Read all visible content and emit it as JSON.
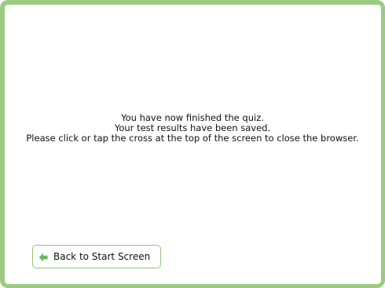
{
  "message": {
    "line1": "You have now finished the quiz.",
    "line2": "Your test results have been saved.",
    "line3": "Please click or tap the cross at the top of the screen to close the browser."
  },
  "back_button": {
    "label": "Back to Start Screen",
    "icon": "back-arrow-icon"
  },
  "colors": {
    "frame_border": "#9bcb83",
    "button_border": "#8fc57a",
    "arrow_icon": "#6cb85a"
  }
}
